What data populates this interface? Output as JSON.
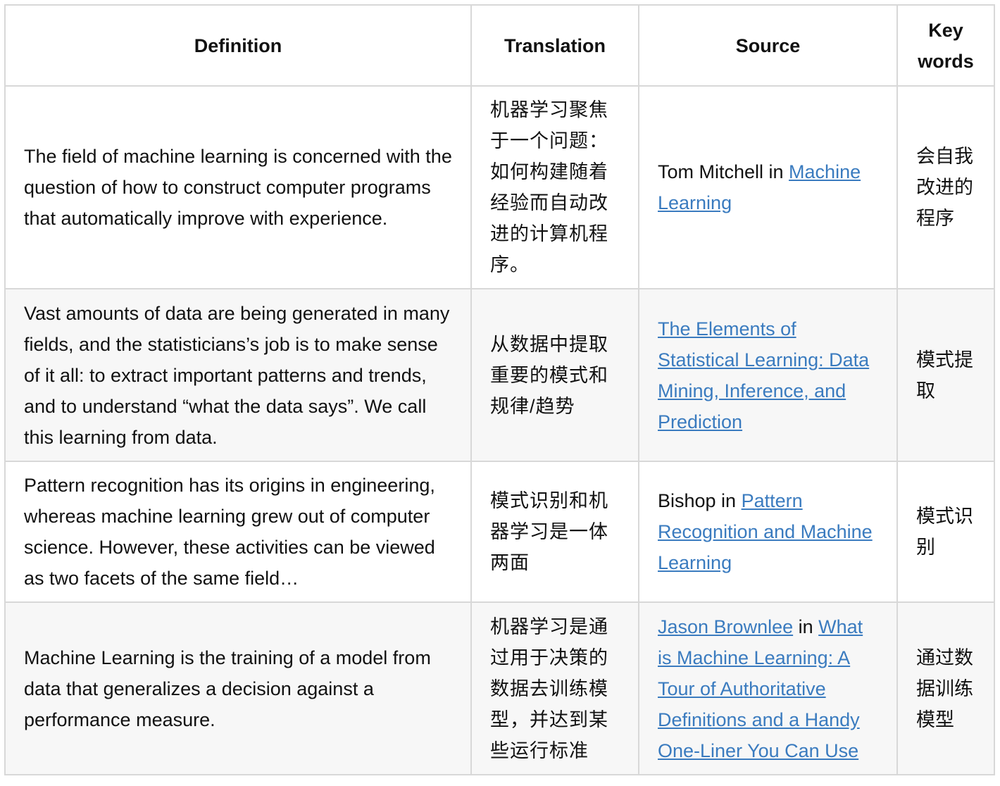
{
  "table": {
    "headers": {
      "definition": "Definition",
      "translation": "Translation",
      "source": "Source",
      "keywords": "Key words"
    },
    "rows": [
      {
        "definition": "The field of machine learning is concerned with the question of how to construct computer programs that automatically improve with experience.",
        "translation": "机器学习聚焦于一个问题：如何构建随着经验而自动改进的计算机程序。",
        "source_prefix": "Tom Mitchell in ",
        "source_author_link": "",
        "source_book_link": "Machine Learning",
        "keywords": "会自我改进的程序"
      },
      {
        "definition": "Vast amounts of data are being generated in many fields, and the statisticians’s job is to make sense of it all: to extract important patterns and trends, and to understand “what the data says”. We call this learning from data.",
        "translation": "从数据中提取重要的模式和规律/趋势",
        "source_prefix": "",
        "source_author_link": "",
        "source_book_link": "The Elements of Statistical Learning: Data Mining, Inference, and Prediction",
        "keywords": "模式提取"
      },
      {
        "definition": "Pattern recognition has its origins in engineering, whereas machine learning grew out of computer science. However, these activities can be viewed as two facets of the same field…",
        "translation": "模式识别和机器学习是一体两面",
        "source_prefix": "Bishop in ",
        "source_author_link": "",
        "source_book_link": "Pattern Recognition and Machine Learning",
        "keywords": "模式识别"
      },
      {
        "definition": "Machine Learning is the training of a model from data that generalizes a decision against a performance measure.",
        "translation": "机器学习是通过用于决策的数据去训练模型，并达到某些运行标准",
        "source_prefix": "",
        "source_author_link": "Jason Brownlee",
        "source_mid": " in ",
        "source_book_link": "What is Machine Learning: A Tour of Authoritative Definitions and a Handy One-Liner You Can Use",
        "keywords": "通过数据训练模型"
      }
    ]
  }
}
